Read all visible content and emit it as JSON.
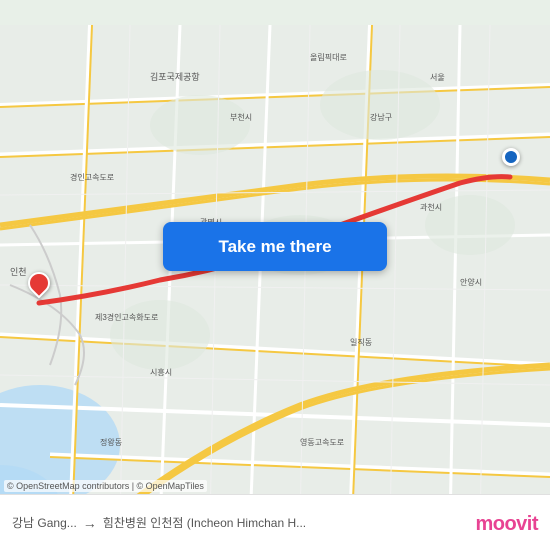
{
  "map": {
    "background_color": "#e8ede8",
    "attribution": "© OpenStreetMap contributors | © OpenMapTiles"
  },
  "button": {
    "label": "Take me there"
  },
  "route": {
    "origin": "강남 Gang...",
    "destination": "힘찬병원 인천점 (Incheon Himchan H..."
  },
  "bottom_bar": {
    "origin_label": "강남 Gang...",
    "arrow": "→",
    "destination_label": "힘찬병원 인천점 (Incheon Himchan H..."
  },
  "logo": {
    "text": "moovit"
  },
  "icons": {
    "arrow": "→"
  }
}
